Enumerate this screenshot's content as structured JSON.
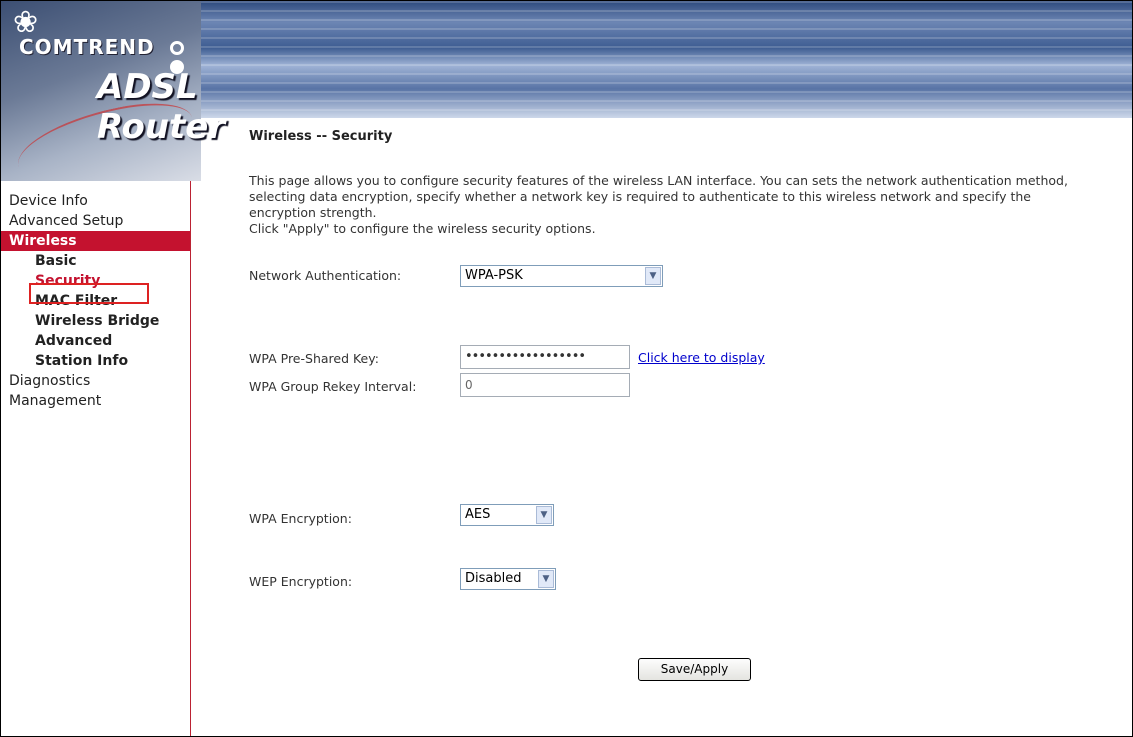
{
  "header": {
    "brand": "COMTREND",
    "product": "ADSL Router"
  },
  "sidebar": {
    "items": [
      {
        "label": "Device Info"
      },
      {
        "label": "Advanced Setup"
      },
      {
        "label": "Wireless"
      },
      {
        "label": "Basic"
      },
      {
        "label": "Security"
      },
      {
        "label": "MAC Filter"
      },
      {
        "label": "Wireless Bridge"
      },
      {
        "label": "Advanced"
      },
      {
        "label": "Station Info"
      },
      {
        "label": "Diagnostics"
      },
      {
        "label": "Management"
      }
    ]
  },
  "main": {
    "title": "Wireless -- Security",
    "description_line1": "This page allows you to configure security features of the wireless LAN interface. You can sets the network authentication method,",
    "description_line2": "selecting data encryption, specify whether a network key is required to authenticate to this wireless network and specify the",
    "description_line3": "encryption strength.",
    "description_line4": "Click \"Apply\" to configure the wireless security options."
  },
  "form": {
    "auth_label": "Network Authentication:",
    "auth_value": "WPA-PSK",
    "psk_label": "WPA Pre-Shared Key:",
    "psk_value": "••••••••••••••••••",
    "psk_link": "Click here to display",
    "rekey_label": "WPA Group Rekey Interval:",
    "rekey_value": "0",
    "wpa_enc_label": "WPA Encryption:",
    "wpa_enc_value": "AES",
    "wep_enc_label": "WEP Encryption:",
    "wep_enc_value": "Disabled",
    "save_label": "Save/Apply"
  },
  "colors": {
    "accent": "#c4122f",
    "link": "#0000cc"
  }
}
